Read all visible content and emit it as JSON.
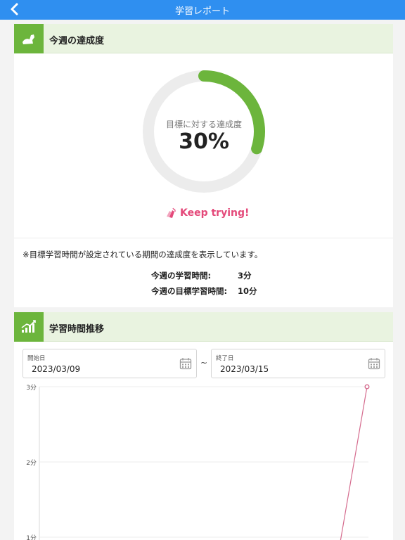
{
  "header": {
    "title": "学習レポート"
  },
  "weekly_card": {
    "title": "今週の達成度",
    "gauge_caption": "目標に対する達成度",
    "percent_label": "30%",
    "progress": 0.3,
    "cheer": "Keep trying!",
    "note": "※目標学習時間が設定されている期間の達成度を表示しています。",
    "study_time_label": "今週の学習時間:",
    "study_time_value": "3分",
    "goal_time_label": "今週の目標学習時間:",
    "goal_time_value": "10分"
  },
  "trend_card": {
    "title": "学習時間推移",
    "start_label": "開始日",
    "start_value": "2023/03/09",
    "separator": "~",
    "end_label": "終了日",
    "end_value": "2023/03/15"
  },
  "colors": {
    "nav": "#2f8ff0",
    "accent_green": "#6cb53c",
    "header_bg": "#e9f3e0",
    "line": "#d56b8e",
    "cheer": "#e4497a"
  },
  "icons": {
    "back": "chevron-left-icon",
    "arm": "flexed-arm-icon",
    "chart": "growth-chart-icon",
    "calendar": "calendar-icon",
    "cheer": "clapping-hands-icon"
  },
  "chart_data": {
    "type": "line",
    "y_tick_labels": [
      "3分",
      "2分",
      "1分"
    ],
    "ylim": [
      1,
      3
    ],
    "series": [
      {
        "values": [
          {
            "x": "visible-end",
            "y": 3
          }
        ]
      }
    ],
    "grid": true
  }
}
